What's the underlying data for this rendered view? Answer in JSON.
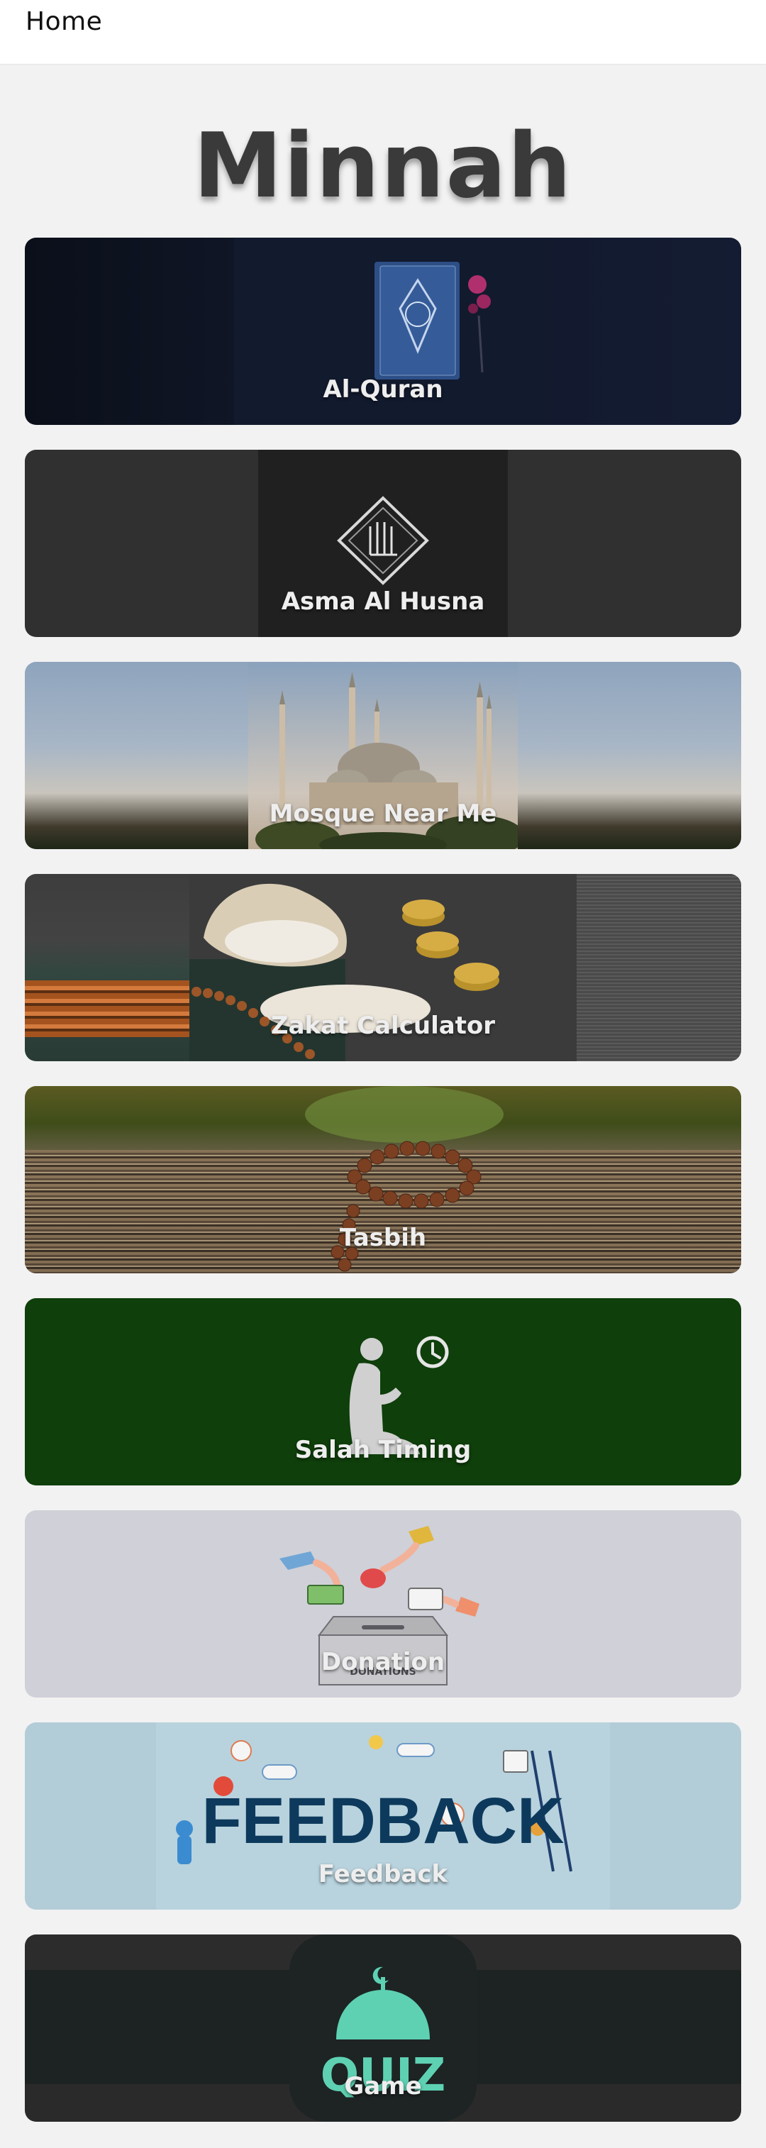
{
  "header": {
    "title": "Home"
  },
  "app_title": "Minnah",
  "cards": [
    {
      "label": "Al-Quran"
    },
    {
      "label": "Asma Al Husna"
    },
    {
      "label": "Mosque Near Me"
    },
    {
      "label": "Zakat Calculator"
    },
    {
      "label": "Tasbih"
    },
    {
      "label": "Salah Timing"
    },
    {
      "label": "Donation",
      "art_text": "DONATIONS"
    },
    {
      "label": "Feedback",
      "art_text": "FEEDBACK"
    },
    {
      "label": "Game",
      "art_text": "QUIZ"
    }
  ],
  "colors": {
    "page_background": "#f2f2f2",
    "title_color": "#3a3a3a",
    "salah_card": "#0f3f0b",
    "quiz_accent": "#5ed1b3",
    "feedback_text": "#0d3a5c"
  }
}
